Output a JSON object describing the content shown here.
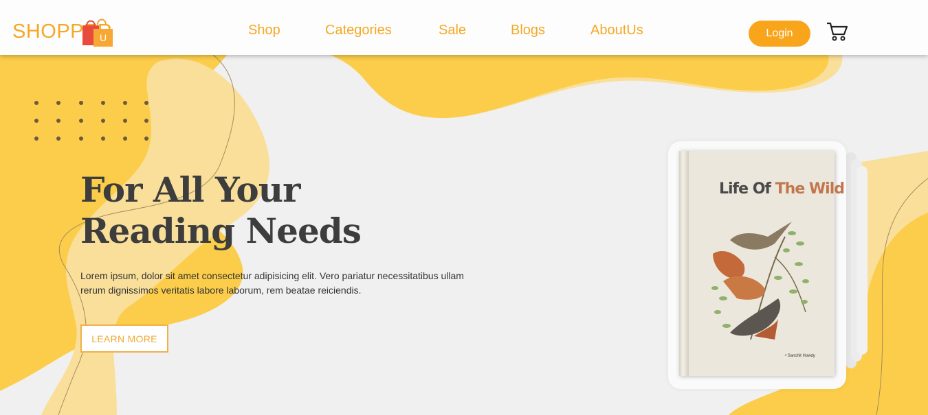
{
  "brand": {
    "name": "SHOPPER",
    "badge": "U"
  },
  "nav": {
    "links": [
      "Shop",
      "Categories",
      "Sale",
      "Blogs",
      "AboutUs"
    ],
    "login_label": "Login",
    "cart_icon": "cart-icon"
  },
  "hero": {
    "title_line1": "For All Your",
    "title_line2": "Reading Needs",
    "description": "Lorem ipsum, dolor sit amet consectetur adipisicing elit. Vero pariatur necessitatibus ullam rerum dignissimos veritatis labore laborum, rem beatae reiciendis.",
    "cta_label": "LEARN MORE"
  },
  "book": {
    "title_part1": "Life Of",
    "title_part2": "The Wild",
    "author": "• Sanchit Howdy"
  },
  "colors": {
    "accent": "#f6a823",
    "blob": "#fbcd4a",
    "blob_light": "#f9df9a",
    "background": "#f0f0f0"
  }
}
